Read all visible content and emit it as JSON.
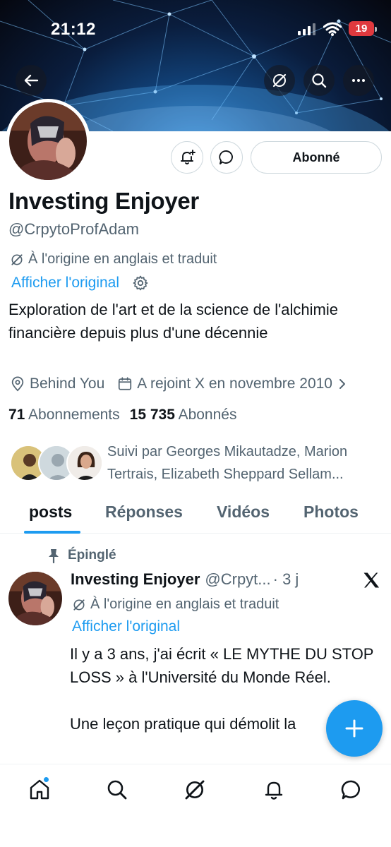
{
  "status_bar": {
    "time": "21:12",
    "battery": "19"
  },
  "profile": {
    "name": "Investing Enjoyer",
    "handle": "@CrpytoProfAdam",
    "translated_note": "À l'origine en anglais et traduit",
    "show_original": "Afficher l'original",
    "bio": "Exploration de l'art et de la science de l'alchimie financière depuis plus d'une décennie",
    "location": "Behind You",
    "joined": "A rejoint X en novembre 2010",
    "following_count": "71",
    "following_label": "Abonnements",
    "followers_count": "15 735",
    "followers_label": "Abonnés",
    "followed_by": "Suivi par Georges Mikautadze, Marion Tertrais, Elizabeth Sheppard Sellam...",
    "follow_button": "Abonné"
  },
  "tabs": [
    "posts",
    "Réponses",
    "Vidéos",
    "Photos"
  ],
  "post": {
    "pinned_label": "Épinglé",
    "author_name": "Investing Enjoyer",
    "author_handle": "@Crpyt...",
    "time": "· 3 j",
    "translated_note": "À l'origine en anglais et traduit",
    "show_original": "Afficher l'original",
    "paragraph_1": "Il y a 3 ans, j'ai écrit « LE MYTHE DU STOP LOSS » à l'Université du Monde Réel.",
    "paragraph_2": "Une leçon pratique qui démolit la"
  },
  "icons": {
    "back": "back-arrow-icon",
    "grok": "grok-icon",
    "search": "search-icon",
    "more": "more-icon",
    "notify": "bell-plus-icon",
    "message": "message-icon",
    "location": "location-icon",
    "calendar": "calendar-icon",
    "pin": "pin-icon",
    "x_logo": "x-logo-icon",
    "compose": "plus-icon",
    "nav": [
      "home-icon",
      "search-icon",
      "grok-icon",
      "bell-icon",
      "message-icon"
    ]
  },
  "colors": {
    "accent": "#1d9bf0",
    "text": "#0f1419",
    "secondary": "#536471",
    "battery": "#e0393e"
  }
}
